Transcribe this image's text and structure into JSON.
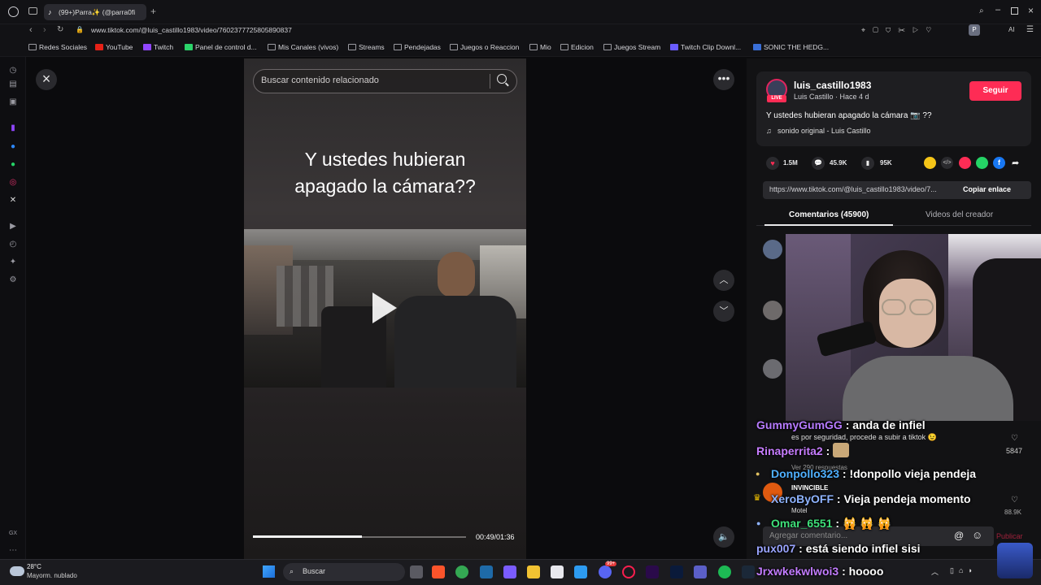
{
  "browser": {
    "tab_label": "(99+)Parra✨ (@parra0fi",
    "url": "www.tiktok.com/@luis_castillo1983/video/7602377725805890837",
    "bookmarks": [
      "Redes Sociales",
      "YouTube",
      "Twitch",
      "Panel de control d...",
      "Mis Canales (vivos)",
      "Streams",
      "Pendejadas",
      "Juegos o Reaccion",
      "Mio",
      "Edicion",
      "Juegos Stream",
      "Twitch Clip Downl...",
      "SONIC THE HEDG..."
    ],
    "ai_label": "AI"
  },
  "video": {
    "search_placeholder": "Buscar contenido relacionado",
    "caption_line1": "Y ustedes hubieran",
    "caption_line2": "apagado la cámara??",
    "time": "00:49/01:36",
    "progress": 0.51
  },
  "creator": {
    "username": "luis_castillo1983",
    "subline": "Luis Castillo · Hace 4 d",
    "live_badge": "LIVE",
    "follow_label": "Seguir",
    "description": "Y ustedes hubieran apagado la cámara 📷 ??",
    "sound": "sonido original - Luis Castillo",
    "likes": "1.5M",
    "comments": "45.9K",
    "saves": "95K",
    "link": "https://www.tiktok.com/@luis_castillo1983/video/7...",
    "copy_label": "Copiar enlace",
    "tab_comments": "Comentarios (45900)",
    "tab_videos": "Videos del creador"
  },
  "comments_bg": {
    "reply_text": "es por seguridad, procede a subir a tiktok 😉",
    "like_count1": "5847",
    "view_replies": "Ver 290 respuestas",
    "invincible": "INVINCIBLE",
    "motel": "Motel",
    "like_count2": "88.9K",
    "add_comment_placeholder": "Agregar comentario...",
    "publish": "Publicar"
  },
  "chat": [
    {
      "name": "GummyGumGG",
      "color": "#b77bff",
      "message": ": anda de infiel"
    },
    {
      "name": "Rinaperrita2",
      "color": "#c77dff",
      "message": ":"
    },
    {
      "name": "Donpollo323",
      "color": "#4fb0ff",
      "message": ": !donpollo vieja pendeja"
    },
    {
      "name": "XeroByOFF",
      "color": "#8fb4ff",
      "message": ": Vieja pendeja momento"
    },
    {
      "name": "Omar_6551",
      "color": "#3fe07a",
      "message": ": 🙀 🙀 🙀"
    },
    {
      "name": "pux007",
      "color": "#9aa4ff",
      "message": ": está siendo infiel sisi"
    },
    {
      "name": "Jrxwkekwlwoi3",
      "color": "#c27cff",
      "message": ": hoooo"
    }
  ],
  "taskbar": {
    "weather_temp": "28°C",
    "weather_desc": "Mayorm. nublado",
    "search_label": "Buscar",
    "badge_count": "99+"
  },
  "colors": {
    "accent": "#fe2c55",
    "bg": "#121214"
  }
}
